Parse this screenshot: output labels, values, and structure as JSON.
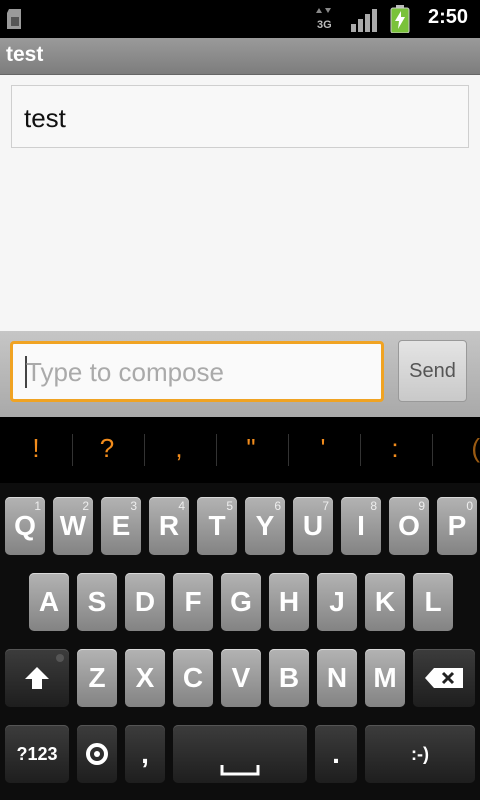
{
  "status_bar": {
    "time": "2:50",
    "icons": [
      "sd-card-icon",
      "data-3g-icon",
      "signal-icon",
      "battery-charging-icon"
    ],
    "data_type": "3G"
  },
  "title_bar": {
    "title": "test"
  },
  "conversation": {
    "messages": [
      {
        "text": "test"
      }
    ]
  },
  "compose": {
    "placeholder": "Type to compose",
    "send_label": "Send",
    "accent_color": "#f0a323"
  },
  "keyboard": {
    "suggestions": [
      "!",
      "?",
      ",",
      "\"",
      "'",
      ":",
      "("
    ],
    "row1": [
      {
        "label": "Q",
        "num": "1"
      },
      {
        "label": "W",
        "num": "2"
      },
      {
        "label": "E",
        "num": "3"
      },
      {
        "label": "R",
        "num": "4"
      },
      {
        "label": "T",
        "num": "5"
      },
      {
        "label": "Y",
        "num": "6"
      },
      {
        "label": "U",
        "num": "7"
      },
      {
        "label": "I",
        "num": "8"
      },
      {
        "label": "O",
        "num": "9"
      },
      {
        "label": "P",
        "num": "0"
      }
    ],
    "row2": [
      "A",
      "S",
      "D",
      "F",
      "G",
      "H",
      "J",
      "K",
      "L"
    ],
    "row3": [
      "Z",
      "X",
      "C",
      "V",
      "B",
      "N",
      "M"
    ],
    "row4": {
      "symbols": "?123",
      "comma": ",",
      "period": ".",
      "smiley": ":-)"
    }
  }
}
